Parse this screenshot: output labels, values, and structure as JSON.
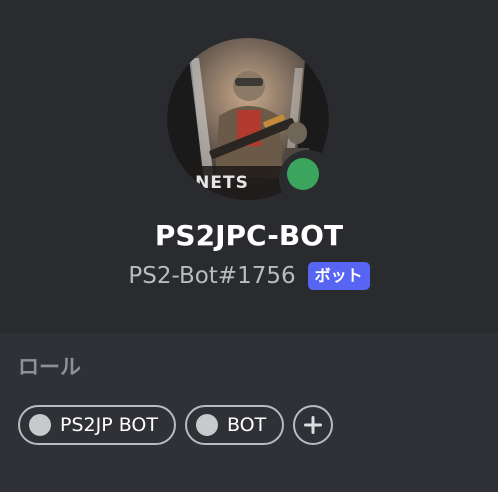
{
  "profile": {
    "username": "PS2JPC-BOT",
    "discriminator": "PS2-Bot#1756",
    "bot_badge": "ボット",
    "status": "online",
    "status_color": "#3ba55d",
    "avatar_text": "ANETS"
  },
  "roles": {
    "title": "ロール",
    "items": [
      {
        "label": "PS2JP BOT",
        "color": "#c7c9cb"
      },
      {
        "label": "BOT",
        "color": "#c7c9cb"
      }
    ],
    "add_icon": "plus-icon"
  },
  "colors": {
    "header_bg": "#292b2f",
    "roles_bg": "#2f3136",
    "badge": "#5865f2"
  }
}
